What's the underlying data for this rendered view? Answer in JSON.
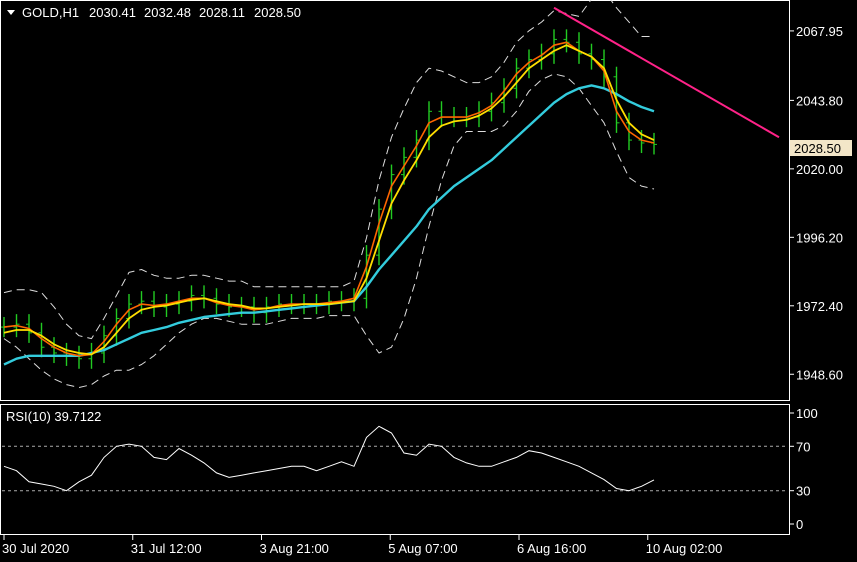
{
  "header": {
    "symbol": "GOLD,H1",
    "open": "2030.41",
    "high": "2032.48",
    "low": "2028.11",
    "close": "2028.50"
  },
  "colors": {
    "background": "#000000",
    "frame": "#ffffff",
    "bars": "#22cc22",
    "ma_fast": "#ff6600",
    "ma_mid": "#ffdd00",
    "ma_slow": "#33ccdd",
    "envelope": "#dddddd",
    "trendline": "#ff2288",
    "rsi": "#ffffff",
    "price_tag_bg": "#f3e6c8"
  },
  "chart_data": [
    {
      "type": "line",
      "title": "GOLD,H1",
      "ylim": [
        1940,
        2078
      ],
      "y_ticks": [
        "2067.95",
        "2043.80",
        "2020.00",
        "1996.20",
        "1972.40",
        "1948.60"
      ],
      "x_ticks": [
        "30 Jul 2020",
        "31 Jul 12:00",
        "3 Aug 21:00",
        "5 Aug 07:00",
        "6 Aug 16:00",
        "10 Aug 02:00"
      ],
      "current_price": "2028.50",
      "series": [
        {
          "key": "close",
          "style": "bars",
          "values": [
            1965,
            1966,
            1963,
            1958,
            1956,
            1955,
            1954,
            1956,
            1962,
            1968,
            1973,
            1974,
            1972,
            1973,
            1974,
            1976,
            1975,
            1973,
            1972,
            1972,
            1970,
            1972,
            1973,
            1973,
            1973,
            1973,
            1974,
            1974,
            1975,
            1990,
            2006,
            2018,
            2024,
            2030,
            2040,
            2038,
            2038,
            2038,
            2040,
            2043,
            2048,
            2055,
            2058,
            2060,
            2065,
            2064,
            2060,
            2058,
            2052,
            2036,
            2030,
            2029,
            2028.5
          ]
        },
        {
          "key": "ma_fast",
          "values": [
            1965,
            1965.5,
            1964.5,
            1961,
            1958,
            1956,
            1955,
            1955.5,
            1960,
            1966,
            1971,
            1973,
            1972.5,
            1973,
            1974,
            1975,
            1975,
            1973.5,
            1972.5,
            1972,
            1971,
            1971.5,
            1972.5,
            1973,
            1973,
            1973,
            1973.5,
            1974,
            1975,
            1986,
            2001,
            2014,
            2021,
            2028,
            2036,
            2038,
            2038,
            2038,
            2039.5,
            2042,
            2047,
            2053,
            2057,
            2059.5,
            2063,
            2064,
            2061,
            2059,
            2054,
            2040,
            2033,
            2030,
            2029
          ]
        },
        {
          "key": "ma_mid",
          "values": [
            1963,
            1964,
            1964,
            1962,
            1959,
            1957,
            1956,
            1955.5,
            1958,
            1963,
            1968,
            1971,
            1972,
            1972.5,
            1973.5,
            1974.5,
            1975,
            1974,
            1973,
            1972.5,
            1971.5,
            1971.5,
            1972,
            1972.5,
            1973,
            1973,
            1973,
            1973.5,
            1974,
            1982,
            1995,
            2008,
            2016,
            2023,
            2031,
            2035,
            2036.5,
            2037,
            2038.5,
            2041,
            2045,
            2050,
            2055,
            2058,
            2061,
            2063,
            2061,
            2059,
            2055,
            2044,
            2036,
            2032,
            2030
          ]
        },
        {
          "key": "ma_slow",
          "values": [
            1952,
            1954,
            1955,
            1955,
            1955,
            1955,
            1955,
            1956,
            1957,
            1959,
            1961,
            1963,
            1964,
            1965,
            1966.5,
            1967.5,
            1968.5,
            1969,
            1969.5,
            1970,
            1970,
            1970.5,
            1971,
            1971.5,
            1972,
            1972.5,
            1973,
            1973.5,
            1974,
            1979,
            1985,
            1990,
            1995,
            2000,
            2006,
            2010,
            2014,
            2017,
            2020,
            2023,
            2027,
            2031,
            2035,
            2039,
            2043,
            2046,
            2048,
            2049,
            2048,
            2046,
            2043.5,
            2041.5,
            2040
          ]
        },
        {
          "key": "env_upper",
          "style": "dashed",
          "values": [
            1977,
            1978,
            1978,
            1977,
            1972,
            1966,
            1962,
            1961,
            1968,
            1976,
            1984,
            1985,
            1983,
            1982,
            1982,
            1983,
            1983,
            1982,
            1981,
            1981,
            1979,
            1979,
            1979,
            1979,
            1979,
            1979,
            1979,
            1979,
            1981,
            1996,
            2016,
            2031,
            2041,
            2050,
            2055,
            2054,
            2052,
            2050,
            2050,
            2052,
            2057,
            2064,
            2068,
            2071,
            2075,
            2074,
            2073,
            2079,
            2082,
            2076,
            2071,
            2066,
            2066
          ]
        },
        {
          "key": "env_lower",
          "style": "dashed",
          "values": [
            1961,
            1958,
            1954,
            1950,
            1947,
            1945,
            1944,
            1945,
            1948,
            1950,
            1950,
            1952,
            1955,
            1959,
            1963,
            1966,
            1968,
            1968,
            1967,
            1966,
            1966,
            1966,
            1967,
            1968,
            1968,
            1968,
            1969,
            1969,
            1969,
            1962,
            1956,
            1958,
            1968,
            1982,
            2000,
            2016,
            2028,
            2033,
            2033,
            2033,
            2035,
            2040,
            2047,
            2051,
            2053,
            2052,
            2048,
            2042,
            2036,
            2026,
            2017,
            2014,
            2013
          ]
        }
      ],
      "trendline": {
        "from": {
          "bar": 44,
          "price": 2076
        },
        "to": {
          "bar": 62,
          "price": 2031
        }
      }
    },
    {
      "type": "line",
      "title": "RSI(10) 39.7122",
      "ylim": [
        0,
        100
      ],
      "y_ticks": [
        "100",
        "70",
        "30",
        "0"
      ],
      "levels": [
        70,
        30
      ],
      "series": [
        {
          "key": "rsi",
          "values": [
            52,
            48,
            38,
            36,
            34,
            30,
            38,
            44,
            60,
            70,
            72,
            70,
            60,
            58,
            68,
            62,
            55,
            46,
            42,
            44,
            46,
            48,
            50,
            52,
            52,
            48,
            52,
            56,
            52,
            78,
            88,
            82,
            64,
            62,
            72,
            70,
            60,
            55,
            52,
            52,
            56,
            60,
            66,
            64,
            60,
            56,
            52,
            46,
            40,
            32,
            30,
            34,
            39.7
          ]
        }
      ]
    }
  ]
}
